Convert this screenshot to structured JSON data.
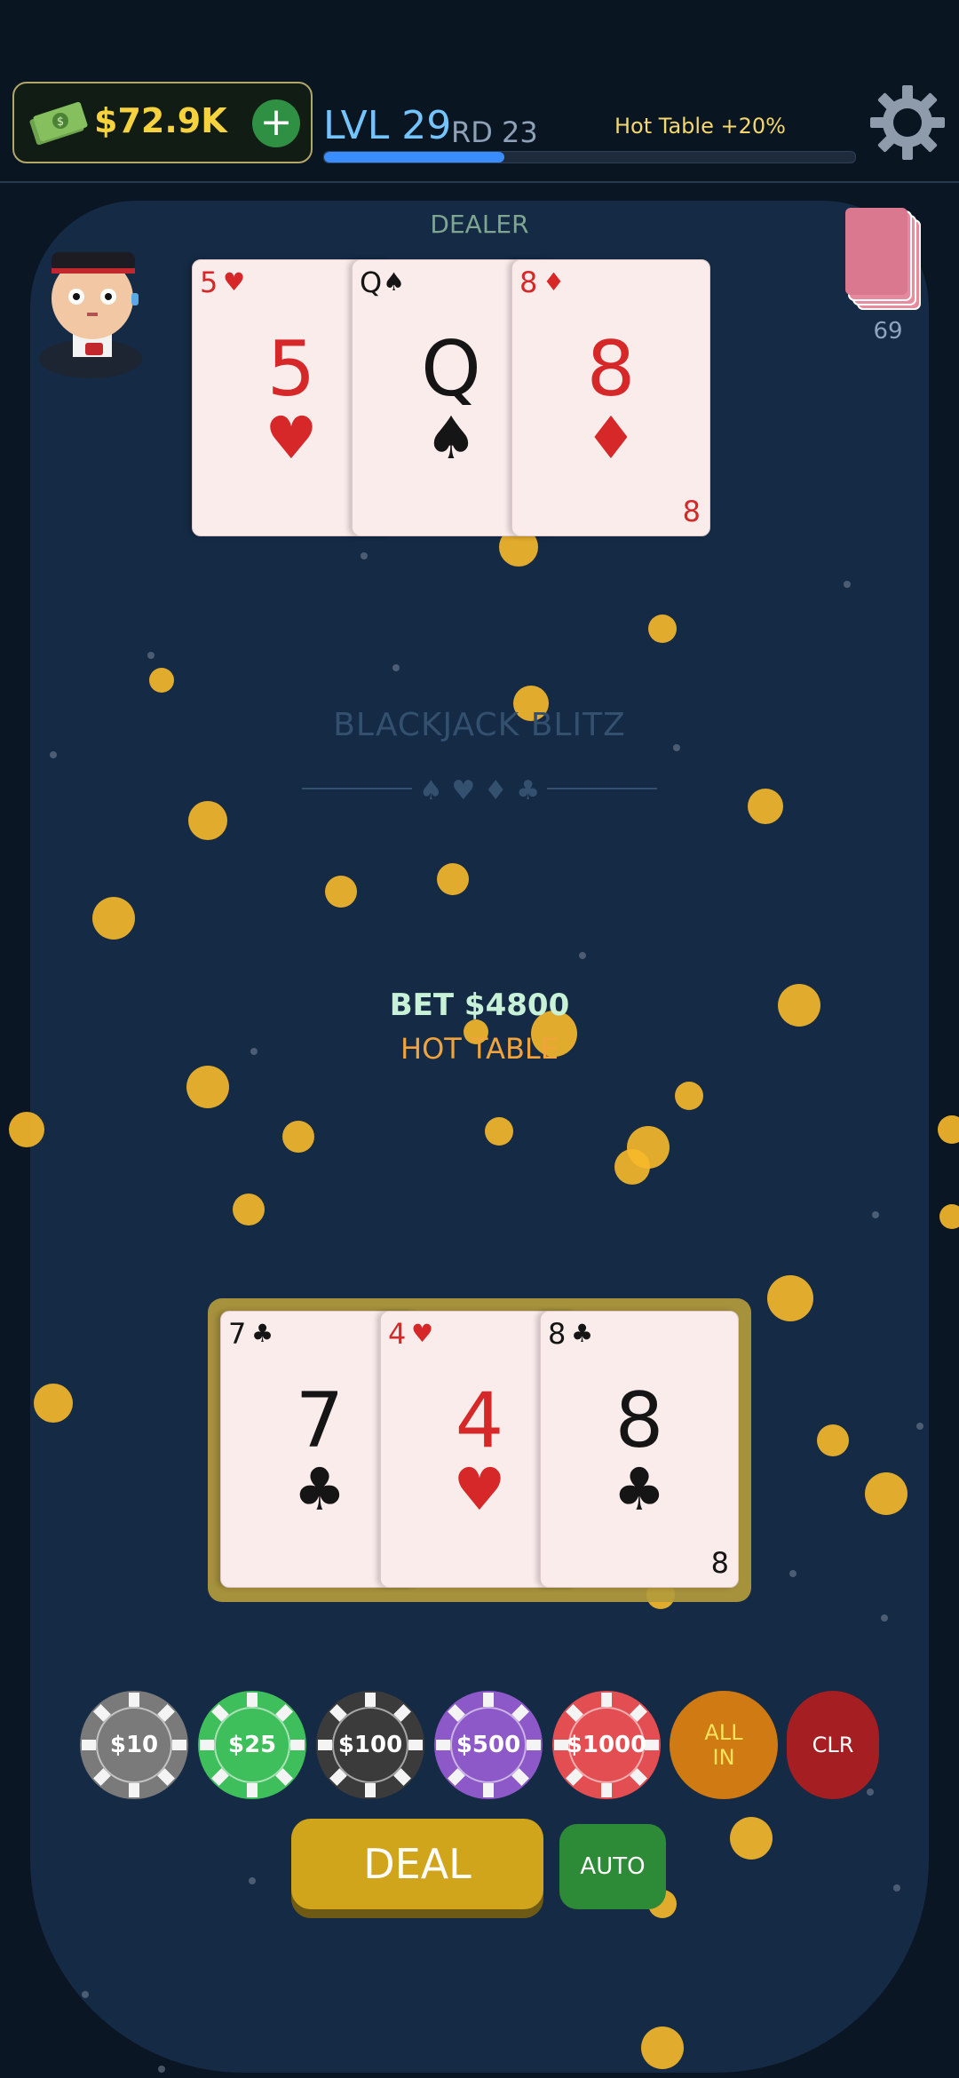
{
  "header": {
    "balance": "$72.9K",
    "add_label": "+",
    "level": "LVL 29",
    "round": "RD 23",
    "bonus": "Hot Table +20%",
    "xp_progress": 0.34
  },
  "dealer": {
    "label": "DEALER",
    "cards": [
      {
        "rank": "5",
        "suit": "♥",
        "color": "red"
      },
      {
        "rank": "Q",
        "suit": "♠",
        "color": "black"
      },
      {
        "rank": "8",
        "suit": "♦",
        "color": "red"
      }
    ]
  },
  "deck": {
    "count": "69"
  },
  "table": {
    "title": "BLACKJACK BLITZ",
    "suits": "♠ ♥ ♦ ♣",
    "bet": "BET $4800",
    "status": "HOT TABLE"
  },
  "player": {
    "cards": [
      {
        "rank": "7",
        "suit": "♣",
        "color": "black"
      },
      {
        "rank": "4",
        "suit": "♥",
        "color": "red"
      },
      {
        "rank": "8",
        "suit": "♣",
        "color": "black"
      }
    ]
  },
  "chips": [
    {
      "label": "$10",
      "color": "#7a7a7a"
    },
    {
      "label": "$25",
      "color": "#3fbf5c"
    },
    {
      "label": "$100",
      "color": "#3b3b3b"
    },
    {
      "label": "$500",
      "color": "#8d58c7"
    },
    {
      "label": "$1000",
      "color": "#e34e52"
    }
  ],
  "controls": {
    "all_in": [
      "ALL",
      "IN"
    ],
    "clear": "CLR",
    "deal": "DEAL",
    "auto": "AUTO"
  }
}
